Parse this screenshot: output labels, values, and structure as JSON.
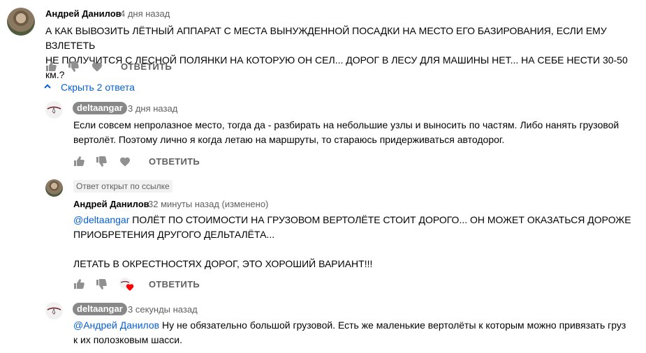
{
  "comment1": {
    "author": "Андрей Данилов",
    "time": "4 дня назад",
    "text_line1": "А КАК ВЫВОЗИТЬ ЛЁТНЫЙ АППАРАТ С МЕСТА ВЫНУЖДЕННОЙ ПОСАДКИ НА МЕСТО ЕГО БАЗИРОВАНИЯ, ЕСЛИ ЕМУ  ВЗЛЕТЕТЬ",
    "text_line2": "НЕ ПОЛУЧИТСЯ С ЛЕСНОЙ ПОЛЯНКИ НА КОТОРУЮ ОН СЕЛ... ДОРОГ В ЛЕСУ ДЛЯ МАШИНЫ НЕТ... НА СЕБЕ НЕСТИ 30-50 км.?",
    "reply_label": "ОТВЕТИТЬ"
  },
  "replies_toggle": {
    "label": "Скрыть 2 ответа"
  },
  "reply1": {
    "author": "deltaangar",
    "time": "3 дня назад",
    "text_line1": "Если совсем непролазное место, тогда да - разбирать на небольшие узлы и выносить по частям. Либо нанять грузовой",
    "text_line2": "вертолёт. Поэтому лично я когда летаю на маршруты, то стараюсь придерживаться автодорог.",
    "reply_label": "ОТВЕТИТЬ"
  },
  "reply2": {
    "linked_label": "Ответ открыт по ссылке",
    "author": "Андрей Данилов",
    "time": "32 минуты назад (изменено)",
    "mention": "@deltaangar",
    "text_line1": " ПОЛЁТ ПО СТОИМОСТИ НА ГРУЗОВОМ ВЕРТОЛЁТЕ СТОИТ ДОРОГО... ОН МОЖЕТ ОКАЗАТЬСЯ ДОРОЖЕ",
    "text_line2": "ПРИОБРЕТЕНИЯ ДРУГОГО ДЕЛЬТАЛЁТА...",
    "text_line3": "ЛЕТАТЬ В ОКРЕСТНОСТЯХ ДОРОГ, ЭТО ХОРОШИЙ ВАРИАНТ!!!",
    "reply_label": "ОТВЕТИТЬ"
  },
  "reply3": {
    "author": "deltaangar",
    "time": "3 секунды назад",
    "mention": "@Андрей Данилов",
    "text_line1": " Ну не обязательно большой грузовой. Есть же маленькие вертолёты к которым можно привязать груз",
    "text_line2": "к их полозковым шасси."
  },
  "colors": {
    "link": "#065fd4",
    "text": "#030303",
    "muted": "#606060",
    "heart": "#ff0000"
  }
}
